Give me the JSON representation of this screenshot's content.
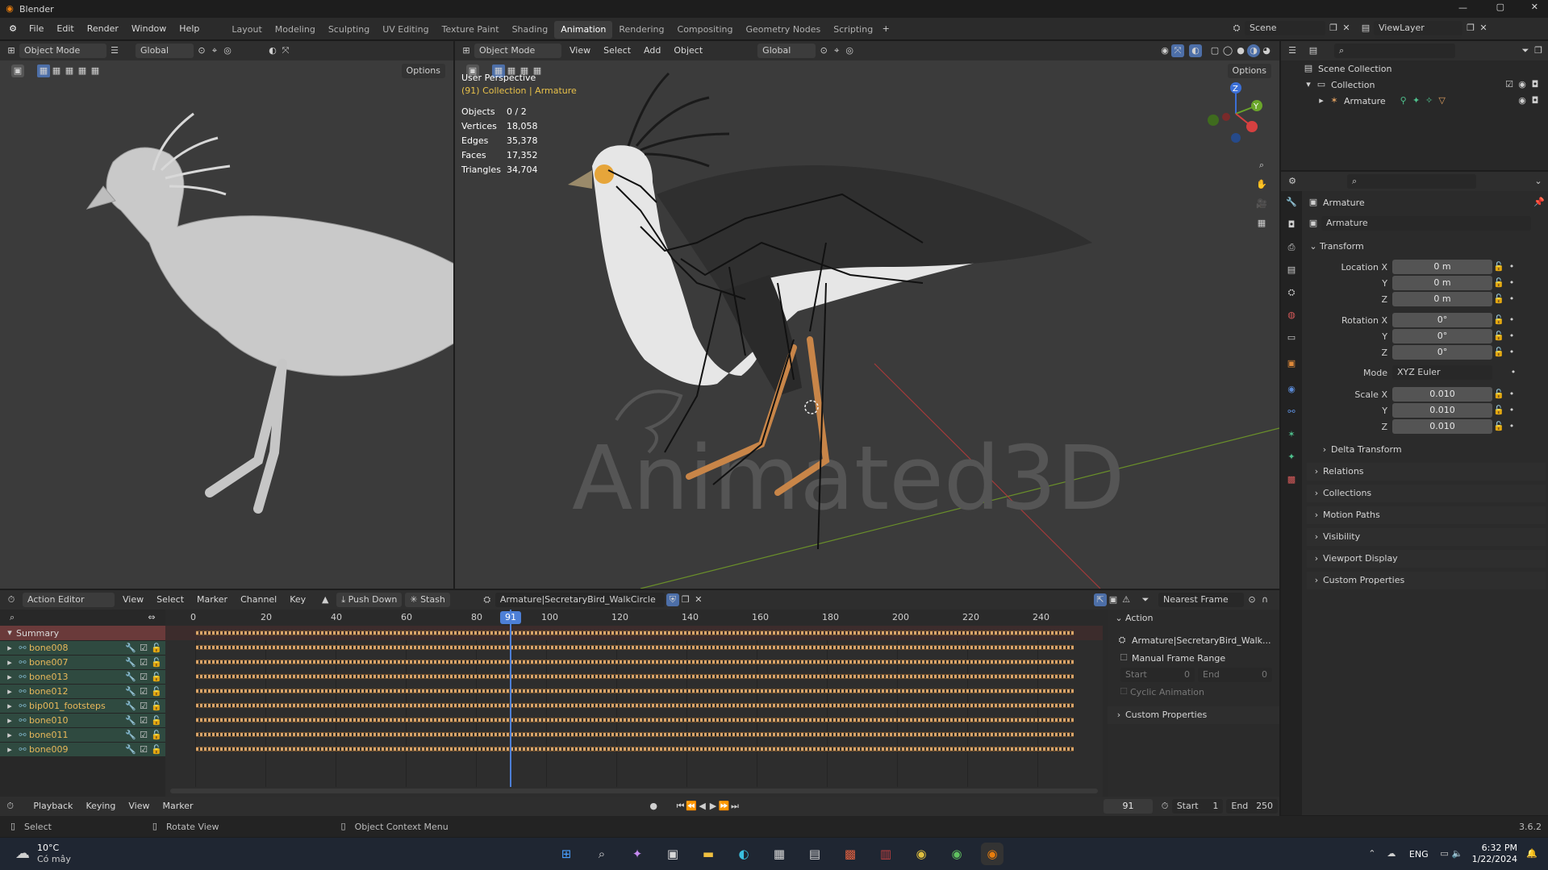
{
  "window": {
    "title": "Blender"
  },
  "menu": [
    "File",
    "Edit",
    "Render",
    "Window",
    "Help"
  ],
  "workspaces": [
    "Layout",
    "Modeling",
    "Sculpting",
    "UV Editing",
    "Texture Paint",
    "Shading",
    "Animation",
    "Rendering",
    "Compositing",
    "Geometry Nodes",
    "Scripting"
  ],
  "active_workspace": "Animation",
  "scene": "Scene",
  "view_layer": "ViewLayer",
  "left_viewport": {
    "mode": "Object Mode",
    "orientation": "Global",
    "options": "Options"
  },
  "main_viewport": {
    "mode": "Object Mode",
    "menus": [
      "View",
      "Select",
      "Add",
      "Object"
    ],
    "orientation": "Global",
    "options": "Options",
    "perspective": "User Perspective",
    "collection_label": "(91) Collection | Armature",
    "stats": [
      {
        "label": "Objects",
        "value": "0 / 2"
      },
      {
        "label": "Vertices",
        "value": "18,058"
      },
      {
        "label": "Edges",
        "value": "35,378"
      },
      {
        "label": "Faces",
        "value": "17,352"
      },
      {
        "label": "Triangles",
        "value": "34,704"
      }
    ],
    "watermark": "Animated3D"
  },
  "outliner": {
    "root": "Scene Collection",
    "collection": "Collection",
    "object": "Armature"
  },
  "properties": {
    "object_name": "Armature",
    "data_name": "Armature",
    "transform_title": "Transform",
    "location": {
      "label": "Location X",
      "x": "0 m",
      "y": "0 m",
      "z": "0 m"
    },
    "rotation": {
      "label": "Rotation X",
      "x": "0°",
      "y": "0°",
      "z": "0°"
    },
    "mode_label": "Mode",
    "mode_value": "XYZ Euler",
    "scale": {
      "label": "Scale X",
      "x": "0.010",
      "y": "0.010",
      "z": "0.010"
    },
    "axis_y": "Y",
    "axis_z": "Z",
    "subsections": [
      "Delta Transform"
    ],
    "sections": [
      "Relations",
      "Collections",
      "Motion Paths",
      "Visibility",
      "Viewport Display",
      "Custom Properties"
    ]
  },
  "action_editor": {
    "editor_mode": "Action Editor",
    "menus": [
      "View",
      "Select",
      "Marker",
      "Channel",
      "Key"
    ],
    "push_down": "Push Down",
    "stash": "Stash",
    "action_name": "Armature|SecretaryBird_WalkCircle",
    "snap": "Nearest Frame",
    "ruler": [
      "0",
      "20",
      "40",
      "60",
      "80",
      "100",
      "120",
      "140",
      "160",
      "180",
      "200",
      "220",
      "240"
    ],
    "current_frame": "91",
    "summary": "Summary",
    "channels": [
      "bone008",
      "bone007",
      "bone013",
      "bone012",
      "bip001_footsteps",
      "bone010",
      "bone011",
      "bone009"
    ],
    "side_panel": {
      "title": "Action",
      "action": "Armature|SecretaryBird_Walk...",
      "manual_range": "Manual Frame Range",
      "start_label": "Start",
      "start_value": "0",
      "end_label": "End",
      "end_value": "0",
      "cyclic": "Cyclic Animation",
      "custom_props": "Custom Properties"
    }
  },
  "timeline": {
    "menus": [
      "Playback",
      "Keying",
      "View",
      "Marker"
    ],
    "frame": "91",
    "start_label": "Start",
    "start": "1",
    "end_label": "End",
    "end": "250"
  },
  "statusbar": {
    "select": "Select",
    "rotate": "Rotate View",
    "context": "Object Context Menu",
    "version": "3.6.2"
  },
  "taskbar": {
    "temp": "10°C",
    "weather": "Có mây",
    "lang": "ENG",
    "time": "6:32 PM",
    "date": "1/22/2024"
  }
}
